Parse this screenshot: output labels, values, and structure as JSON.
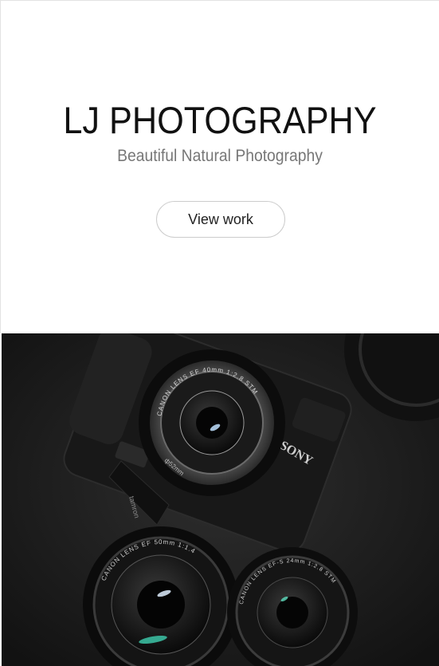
{
  "hero": {
    "title": "LJ PHOTOGRAPHY",
    "tagline": "Beautiful Natural Photography",
    "cta_label": "View work"
  },
  "photo": {
    "camera_brand": "SONY",
    "lens_top": "CANON LENS EF 40mm 1:2.8 STM",
    "lens_left": "CANON LENS EF 50mm 1:1.4",
    "lens_right": "CANON LENS EF-S 24mm 1:2.8 STM",
    "filter_size": "ф52mm",
    "strap": "tamron"
  },
  "colors": {
    "title": "#111111",
    "tagline": "#777777",
    "button_border": "#cccccc",
    "photo_bg": "#1c1c1c"
  }
}
